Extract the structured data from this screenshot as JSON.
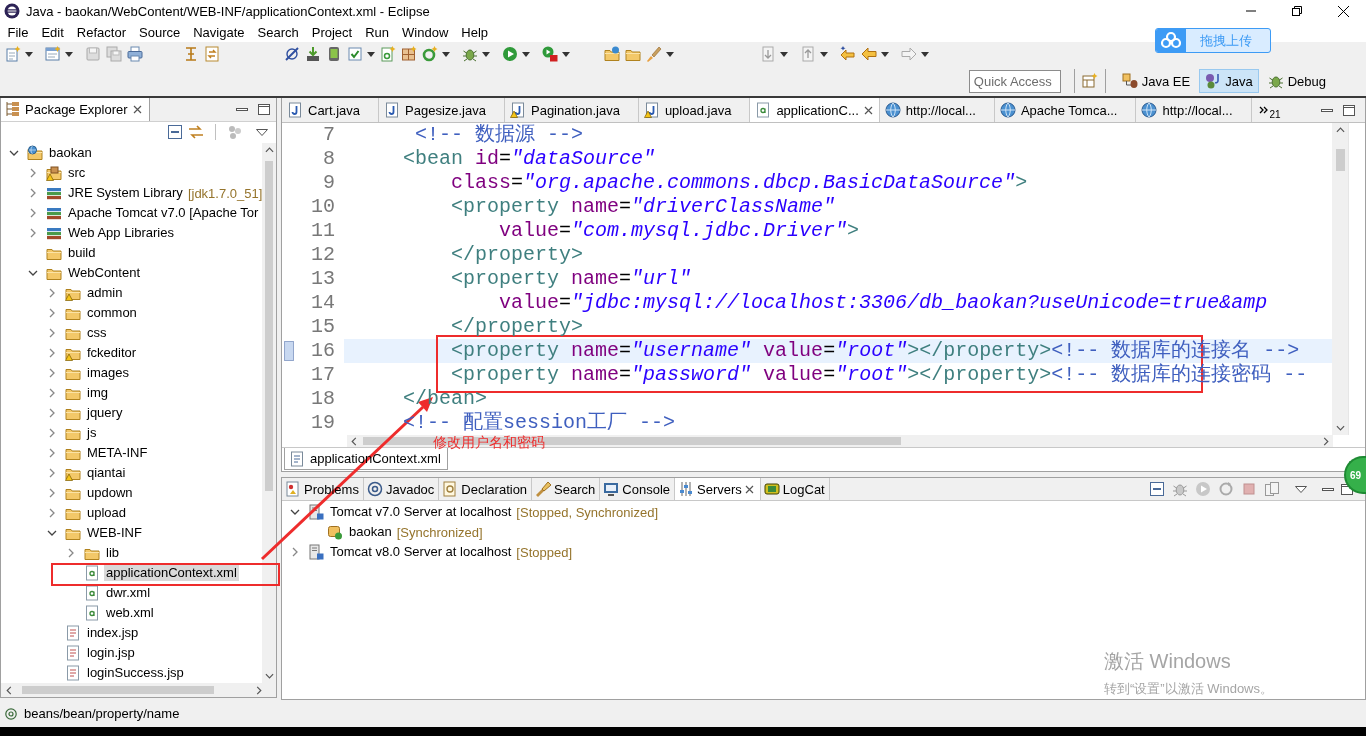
{
  "window": {
    "title": "Java - baokan/WebContent/WEB-INF/applicationContext.xml - Eclipse"
  },
  "menu": [
    "File",
    "Edit",
    "Refactor",
    "Source",
    "Navigate",
    "Search",
    "Project",
    "Run",
    "Window",
    "Help"
  ],
  "upload_widget": {
    "label": "拖拽上传"
  },
  "quick_access": {
    "placeholder": "Quick Access"
  },
  "perspectives": [
    {
      "label": "Java EE",
      "kind": "javaee",
      "selected": false
    },
    {
      "label": "Java",
      "kind": "java",
      "selected": true
    },
    {
      "label": "Debug",
      "kind": "debug",
      "selected": false
    }
  ],
  "package_explorer": {
    "title": "Package Explorer",
    "tree": [
      {
        "label": "baokan",
        "kind": "project",
        "expanded": true,
        "warning": false,
        "selected": false,
        "children": [
          {
            "label": "src",
            "kind": "package",
            "expanded": false,
            "warning": true,
            "selected": false
          },
          {
            "label": "JRE System Library",
            "decoration": "[jdk1.7.0_51]",
            "kind": "library",
            "expanded": false,
            "warning": false,
            "selected": false
          },
          {
            "label": "Apache Tomcat v7.0 [Apache Tor",
            "kind": "library",
            "expanded": false,
            "warning": false,
            "selected": false
          },
          {
            "label": "Web App Libraries",
            "kind": "library",
            "expanded": false,
            "warning": false,
            "selected": false
          },
          {
            "label": "build",
            "kind": "folder",
            "warning": false,
            "selected": false
          },
          {
            "label": "WebContent",
            "kind": "folder",
            "expanded": true,
            "warning": false,
            "selected": false,
            "children": [
              {
                "label": "admin",
                "kind": "folder",
                "expanded": false,
                "warning": true,
                "selected": false
              },
              {
                "label": "common",
                "kind": "folder",
                "expanded": false,
                "warning": false,
                "selected": false
              },
              {
                "label": "css",
                "kind": "folder",
                "expanded": false,
                "warning": false,
                "selected": false
              },
              {
                "label": "fckeditor",
                "kind": "folder",
                "expanded": false,
                "warning": true,
                "selected": false
              },
              {
                "label": "images",
                "kind": "folder",
                "expanded": false,
                "warning": false,
                "selected": false
              },
              {
                "label": "img",
                "kind": "folder",
                "expanded": false,
                "warning": false,
                "selected": false
              },
              {
                "label": "jquery",
                "kind": "folder",
                "expanded": false,
                "warning": false,
                "selected": false
              },
              {
                "label": "js",
                "kind": "folder",
                "expanded": false,
                "warning": false,
                "selected": false
              },
              {
                "label": "META-INF",
                "kind": "folder",
                "expanded": false,
                "warning": false,
                "selected": false
              },
              {
                "label": "qiantai",
                "kind": "folder",
                "expanded": false,
                "warning": true,
                "selected": false
              },
              {
                "label": "updown",
                "kind": "folder",
                "expanded": false,
                "warning": false,
                "selected": false
              },
              {
                "label": "upload",
                "kind": "folder",
                "expanded": false,
                "warning": false,
                "selected": false
              },
              {
                "label": "WEB-INF",
                "kind": "folder",
                "expanded": true,
                "warning": false,
                "selected": false,
                "children": [
                  {
                    "label": "lib",
                    "kind": "folder",
                    "expanded": false,
                    "warning": false,
                    "selected": false
                  },
                  {
                    "label": "applicationContext.xml",
                    "kind": "xml",
                    "warning": false,
                    "selected": true
                  },
                  {
                    "label": "dwr.xml",
                    "kind": "xml",
                    "warning": false,
                    "selected": false
                  },
                  {
                    "label": "web.xml",
                    "kind": "xml",
                    "warning": false,
                    "selected": false
                  }
                ]
              },
              {
                "label": "index.jsp",
                "kind": "jsp",
                "warning": false,
                "selected": false
              },
              {
                "label": "login.jsp",
                "kind": "jsp",
                "warning": false,
                "selected": false
              },
              {
                "label": "loginSuccess.jsp",
                "kind": "jsp",
                "warning": false,
                "selected": false
              }
            ]
          }
        ]
      }
    ]
  },
  "editor": {
    "tabs": [
      {
        "label": "Cart.java",
        "kind": "java",
        "warning": false,
        "selected": false
      },
      {
        "label": "Pagesize.java",
        "kind": "java",
        "warning": false,
        "selected": false
      },
      {
        "label": "Pagination.java",
        "kind": "java",
        "warning": true,
        "selected": false
      },
      {
        "label": "upload.java",
        "kind": "java",
        "warning": true,
        "selected": false
      },
      {
        "label": "applicationC...",
        "kind": "xml",
        "warning": false,
        "selected": true
      },
      {
        "label": "http://local...",
        "kind": "web",
        "warning": false,
        "selected": false
      },
      {
        "label": "Apache Tomca...",
        "kind": "web",
        "warning": false,
        "selected": false
      },
      {
        "label": "http://local...",
        "kind": "web",
        "warning": false,
        "selected": false
      }
    ],
    "hidden_tab_count": "21",
    "lines": [
      {
        "number": "7",
        "current": false,
        "tokens": [
          {
            "kind": "comment",
            "text": "     <!-- 数据源 -->"
          }
        ]
      },
      {
        "number": "8",
        "current": false,
        "tokens": [
          {
            "kind": "tag",
            "text": "    <bean"
          },
          {
            "kind": "attr",
            "text": " id"
          },
          {
            "kind": "punct",
            "text": "="
          },
          {
            "kind": "value",
            "text": "\"dataSource\""
          }
        ]
      },
      {
        "number": "9",
        "current": false,
        "tokens": [
          {
            "kind": "attr",
            "text": "        class"
          },
          {
            "kind": "punct",
            "text": "="
          },
          {
            "kind": "value",
            "text": "\"org.apache.commons.dbcp.BasicDataSource\""
          },
          {
            "kind": "tag",
            "text": ">"
          }
        ]
      },
      {
        "number": "10",
        "current": false,
        "tokens": [
          {
            "kind": "tag",
            "text": "        <property"
          },
          {
            "kind": "attr",
            "text": " name"
          },
          {
            "kind": "punct",
            "text": "="
          },
          {
            "kind": "value",
            "text": "\"driverClassName\""
          }
        ]
      },
      {
        "number": "11",
        "current": false,
        "tokens": [
          {
            "kind": "attr",
            "text": "            value"
          },
          {
            "kind": "punct",
            "text": "="
          },
          {
            "kind": "value",
            "text": "\"com.mysql.jdbc.Driver\""
          },
          {
            "kind": "tag",
            "text": ">"
          }
        ]
      },
      {
        "number": "12",
        "current": false,
        "tokens": [
          {
            "kind": "tag",
            "text": "        </property>"
          }
        ]
      },
      {
        "number": "13",
        "current": false,
        "tokens": [
          {
            "kind": "tag",
            "text": "        <property"
          },
          {
            "kind": "attr",
            "text": " name"
          },
          {
            "kind": "punct",
            "text": "="
          },
          {
            "kind": "value",
            "text": "\"url\""
          }
        ]
      },
      {
        "number": "14",
        "current": false,
        "tokens": [
          {
            "kind": "attr",
            "text": "            value"
          },
          {
            "kind": "punct",
            "text": "="
          },
          {
            "kind": "value",
            "text": "\"jdbc:mysql://localhost:3306/db_baokan?useUnicode=true&amp"
          }
        ]
      },
      {
        "number": "15",
        "current": false,
        "tokens": [
          {
            "kind": "tag",
            "text": "        </property>"
          }
        ]
      },
      {
        "number": "16",
        "current": true,
        "tokens": [
          {
            "kind": "tag",
            "text": "        <property"
          },
          {
            "kind": "attr",
            "text": " name"
          },
          {
            "kind": "punct",
            "text": "="
          },
          {
            "kind": "value",
            "text": "\"username\""
          },
          {
            "kind": "attr",
            "text": " value"
          },
          {
            "kind": "punct",
            "text": "="
          },
          {
            "kind": "value",
            "text": "\"root\""
          },
          {
            "kind": "tag",
            "text": "></property>"
          },
          {
            "kind": "comment",
            "text": "<!-- 数据库的连接名 -->"
          }
        ]
      },
      {
        "number": "17",
        "current": false,
        "tokens": [
          {
            "kind": "tag",
            "text": "        <property"
          },
          {
            "kind": "attr",
            "text": " name"
          },
          {
            "kind": "punct",
            "text": "="
          },
          {
            "kind": "value",
            "text": "\"password\""
          },
          {
            "kind": "attr",
            "text": " value"
          },
          {
            "kind": "punct",
            "text": "="
          },
          {
            "kind": "value",
            "text": "\"root\""
          },
          {
            "kind": "tag",
            "text": "></property>"
          },
          {
            "kind": "comment",
            "text": "<!-- 数据库的连接密码 --"
          }
        ]
      },
      {
        "number": "18",
        "current": false,
        "tokens": [
          {
            "kind": "tag",
            "text": "    </bean>"
          }
        ]
      },
      {
        "number": "19",
        "current": false,
        "tokens": [
          {
            "kind": "comment",
            "text": "    <!-- 配置session工厂 -->"
          }
        ]
      }
    ],
    "bottom_tab": "applicationContext.xml"
  },
  "bottom_panel": {
    "tabs": [
      {
        "label": "Problems",
        "kind": "problems",
        "selected": false
      },
      {
        "label": "Javadoc",
        "kind": "javadoc",
        "selected": false
      },
      {
        "label": "Declaration",
        "kind": "declaration",
        "selected": false
      },
      {
        "label": "Search",
        "kind": "search",
        "selected": false
      },
      {
        "label": "Console",
        "kind": "console",
        "selected": false
      },
      {
        "label": "Servers",
        "kind": "servers",
        "selected": true
      },
      {
        "label": "LogCat",
        "kind": "logcat",
        "selected": false
      }
    ],
    "servers": [
      {
        "label": "Tomcat v7.0 Server at localhost",
        "status": "[Stopped, Synchronized]",
        "kind": "server",
        "expanded": true,
        "children": [
          {
            "label": "baokan",
            "status": "[Synchronized]",
            "kind": "module"
          }
        ]
      },
      {
        "label": "Tomcat v8.0 Server at localhost",
        "status": "[Stopped]",
        "kind": "server",
        "expanded": false
      }
    ]
  },
  "status_bar": {
    "text": "beans/bean/property/name"
  },
  "annotation": {
    "text": "修改用户名和密码"
  },
  "activation_notice": {
    "title": "激活 Windows",
    "text": "转到“设置”以激活 Windows。"
  },
  "floating_badge": {
    "text": "69"
  }
}
